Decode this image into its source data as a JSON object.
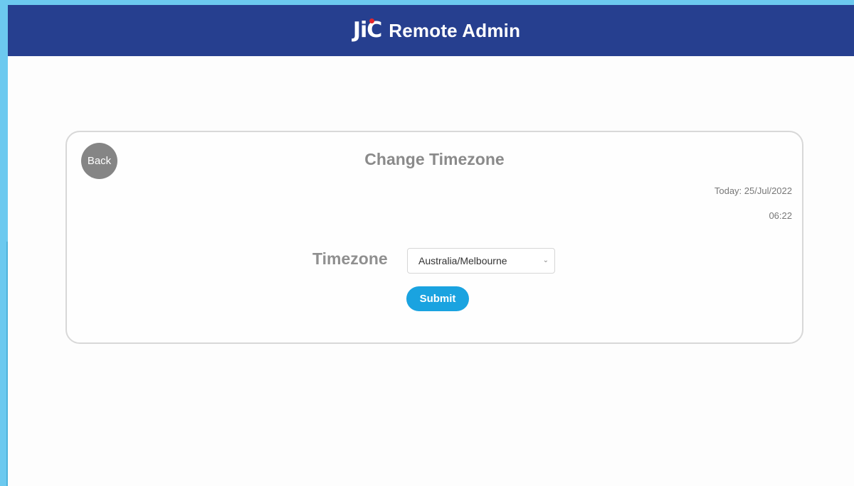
{
  "header": {
    "logo_text": "JiC",
    "title": "Remote Admin"
  },
  "card": {
    "back_label": "Back",
    "title": "Change Timezone",
    "today": "Today: 25/Jul/2022",
    "time": "06:22",
    "timezone_label": "Timezone",
    "timezone_value": "Australia/Melbourne",
    "submit_label": "Submit"
  },
  "colors": {
    "header_bg": "#263f8f",
    "submit_bg": "#1aa3e0",
    "back_bg": "#858585",
    "logo_dot": "#e4262b"
  },
  "icons": {
    "select_chevron": "chevron-down-icon"
  }
}
